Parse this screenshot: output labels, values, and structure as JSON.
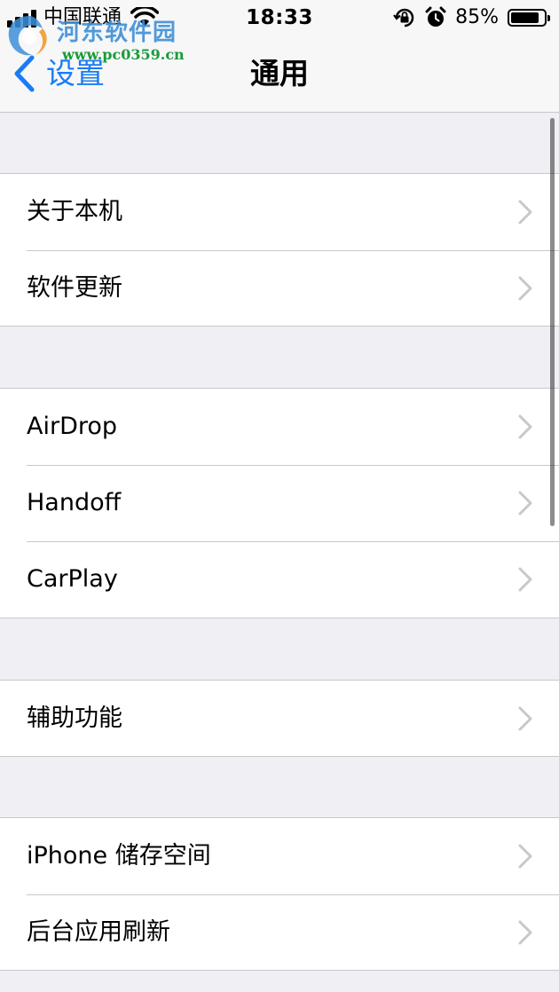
{
  "status_bar": {
    "carrier": "中国联通",
    "time": "18:33",
    "battery_percent": "85%",
    "battery_level": 0.85,
    "icons": [
      "signal-icon",
      "wifi-icon",
      "rotation-lock-icon",
      "alarm-icon",
      "battery-icon"
    ]
  },
  "watermark": {
    "name": "河东软件园",
    "url": "www.pc0359.cn"
  },
  "nav": {
    "back_label": "设置",
    "title": "通用"
  },
  "groups": [
    {
      "items": [
        {
          "label": "关于本机"
        },
        {
          "label": "软件更新"
        }
      ]
    },
    {
      "items": [
        {
          "label": "AirDrop"
        },
        {
          "label": "Handoff"
        },
        {
          "label": "CarPlay"
        }
      ]
    },
    {
      "items": [
        {
          "label": "辅助功能"
        }
      ]
    },
    {
      "items": [
        {
          "label": "iPhone 储存空间"
        },
        {
          "label": "后台应用刷新"
        }
      ]
    }
  ],
  "colors": {
    "accent": "#1a7cf5",
    "background": "#efeff4",
    "separator": "#c8c7cc",
    "chevron": "#c7c7cc"
  }
}
